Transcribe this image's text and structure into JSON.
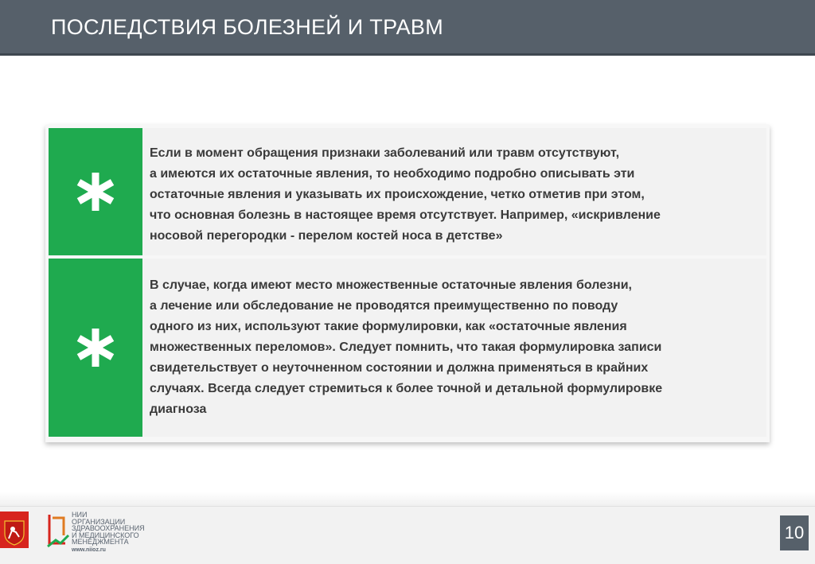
{
  "header": {
    "title": "ПОСЛЕДСТВИЯ БОЛЕЗНЕЙ И ТРАВМ"
  },
  "items": [
    {
      "icon": "asterisk-icon",
      "text": "Если в момент обращения признаки заболеваний или травм отсутствуют,\nа имеются их остаточные явления, то необходимо подробно описывать эти\nостаточные явления и указывать их происхождение, четко отметив при  этом,\nчто  основная  болезнь в настоящее время отсутствует. Например, «искривление\nносовой  перегородки -  перелом  костей  носа в детстве»"
    },
    {
      "icon": "asterisk-icon",
      "text": "В случае, когда имеют место множественные остаточные явления болезни,\nа лечение или обследование не проводятся преимущественно  по  поводу\nодного из них, используют такие формулировки, как «остаточные явления\nмножественных переломов». Следует помнить, что такая формулировка записи\nсвидетельствует о неуточненном состоянии и должна применяться в крайних\nслучаях. Всегда следует стремиться к более точной и детальной формулировке\nдиагноза"
    }
  ],
  "footer": {
    "logo_text": "НИИ\nОРГАНИЗАЦИИ\nЗДРАВООХРАНЕНИЯ\nИ МЕДИЦИНСКОГО\nМЕНЕДЖМЕНТА",
    "logo_url": "www.niioz.ru",
    "page_number": "10"
  },
  "colors": {
    "header_bg": "#56606a",
    "accent_green": "#1faa4f",
    "emblem_red": "#d7251e"
  }
}
